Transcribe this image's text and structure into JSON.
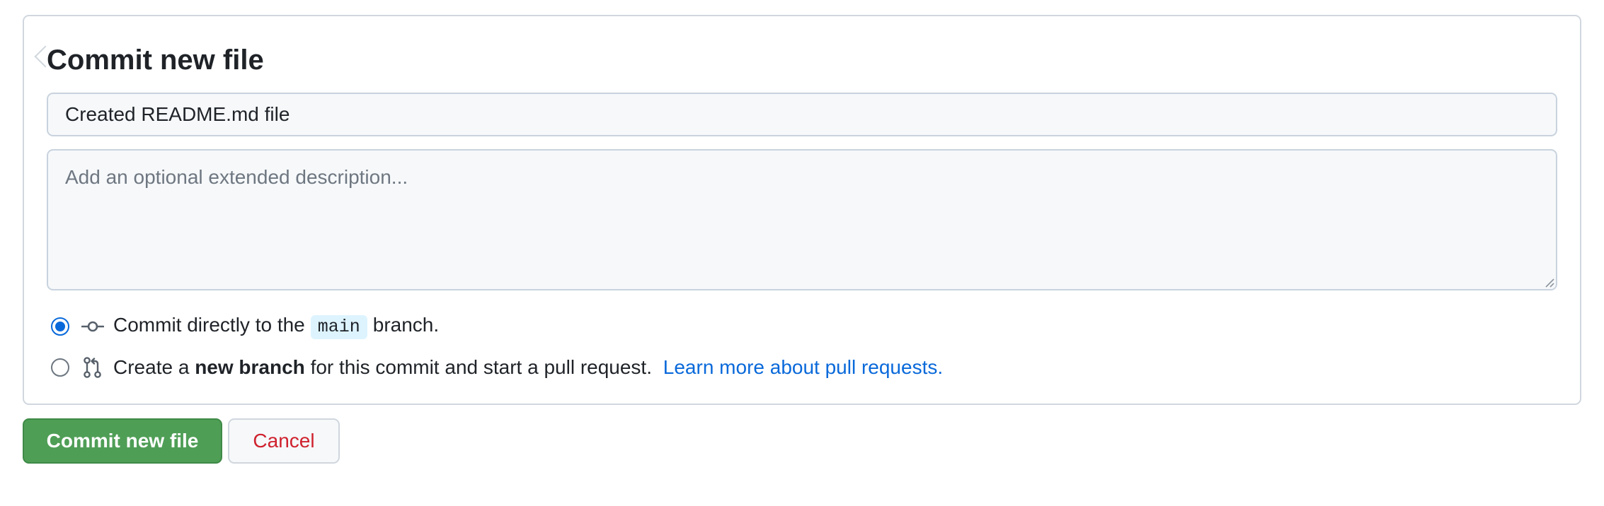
{
  "form": {
    "title": "Commit new file",
    "summary_value": "Created README.md file",
    "description_placeholder": "Add an optional extended description..."
  },
  "options": {
    "direct": {
      "prefix": "Commit directly to the",
      "branch": "main",
      "suffix": "branch.",
      "selected": true,
      "icon": "git-commit-icon"
    },
    "new_branch": {
      "prefix": "Create a",
      "bold": "new branch",
      "suffix": "for this commit and start a pull request.",
      "link": "Learn more about pull requests.",
      "selected": false,
      "icon": "git-pull-request-icon"
    }
  },
  "buttons": {
    "commit_label": "Commit new file",
    "cancel_label": "Cancel"
  },
  "colors": {
    "accent": "#0969da",
    "commit_button": "#4f9e56",
    "cancel_text": "#cf222e",
    "border": "#d0d7de"
  }
}
